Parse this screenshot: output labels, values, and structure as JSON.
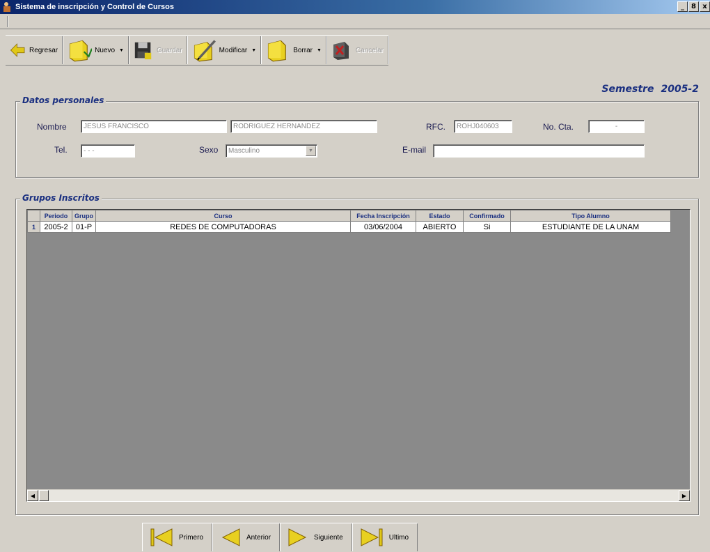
{
  "window": {
    "title": "Sistema de inscripción y Control de Cursos",
    "controls": [
      "_",
      "8",
      "x"
    ]
  },
  "toolbar": {
    "regresar": "Regresar",
    "nuevo": "Nuevo",
    "guardar": "Guardar",
    "modificar": "Modificar",
    "borrar": "Borrar",
    "cancelar": "Cancelar"
  },
  "semestre": {
    "label": "Semestre",
    "value": "2005-2"
  },
  "datos_personales": {
    "legend": "Datos personales",
    "nombre_label": "Nombre",
    "nombre_value": "JESUS FRANCISCO",
    "apellidos_value": "RODRIGUEZ HERNANDEZ",
    "rfc_label": "RFC.",
    "rfc_value": "ROHJ040603",
    "cta_label": "No. Cta.",
    "cta_value": "-",
    "tel_label": "Tel.",
    "tel_value": "- - -",
    "sexo_label": "Sexo",
    "sexo_value": "Masculino",
    "email_label": "E-mail",
    "email_value": ""
  },
  "grupos": {
    "legend": "Grupos Inscritos",
    "columns": [
      "Periodo",
      "Grupo",
      "Curso",
      "Fecha Inscripción",
      "Estado",
      "Confirmado",
      "Tipo Alumno"
    ],
    "rows": [
      {
        "num": "1",
        "periodo": "2005-2",
        "grupo": "01-P",
        "curso": "REDES DE COMPUTADORAS",
        "fecha": "03/06/2004",
        "estado": "ABIERTO",
        "confirmado": "Si",
        "tipo": "ESTUDIANTE DE LA UNAM"
      }
    ]
  },
  "nav": {
    "primero": "Primero",
    "anterior": "Anterior",
    "siguiente": "Siguiente",
    "ultimo": "Ultimo"
  },
  "colors": {
    "titlebar": "#0a246a",
    "accent_text": "#1a2f80",
    "icon_yellow": "#e8d020"
  }
}
